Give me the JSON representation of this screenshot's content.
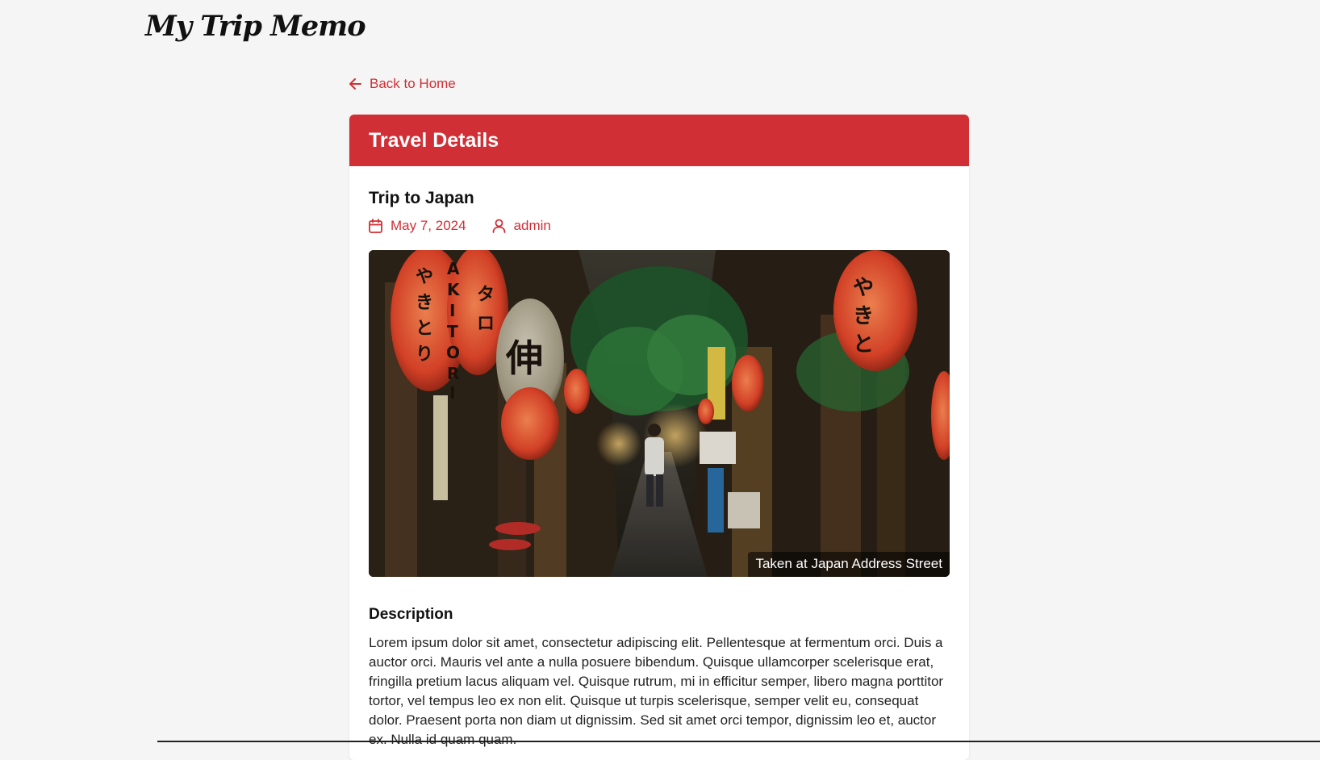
{
  "site": {
    "logo": "My Trip Memo"
  },
  "nav": {
    "back_label": "Back to Home",
    "back_icon": "arrow-left-icon"
  },
  "card": {
    "header": "Travel Details",
    "trip_title": "Trip to Japan",
    "meta": {
      "date": "May 7, 2024",
      "date_icon": "calendar-icon",
      "author": "admin",
      "author_icon": "user-icon"
    },
    "photo": {
      "caption": "Taken at Japan Address Street",
      "lantern_text": [
        "AKITORI",
        "やきとり",
        "タロ",
        "伸",
        "やきとり"
      ]
    },
    "description_title": "Description",
    "description_text": "Lorem ipsum dolor sit amet, consectetur adipiscing elit. Pellentesque at fermentum orci. Duis a auctor orci. Mauris vel ante a nulla posuere bibendum. Quisque ullamcorper scelerisque erat, fringilla pretium lacus aliquam vel. Quisque rutrum, mi in efficitur semper, libero magna porttitor tortor, vel tempus leo ex non elit. Quisque ut turpis scelerisque, semper velit eu, consequat dolor. Praesent porta non diam ut dignissim. Sed sit amet orci tempor, dignissim leo et, auctor ex. Nulla id quam quam."
  },
  "colors": {
    "accent": "#d02f35",
    "background": "#f5f5f5",
    "card": "#ffffff"
  }
}
